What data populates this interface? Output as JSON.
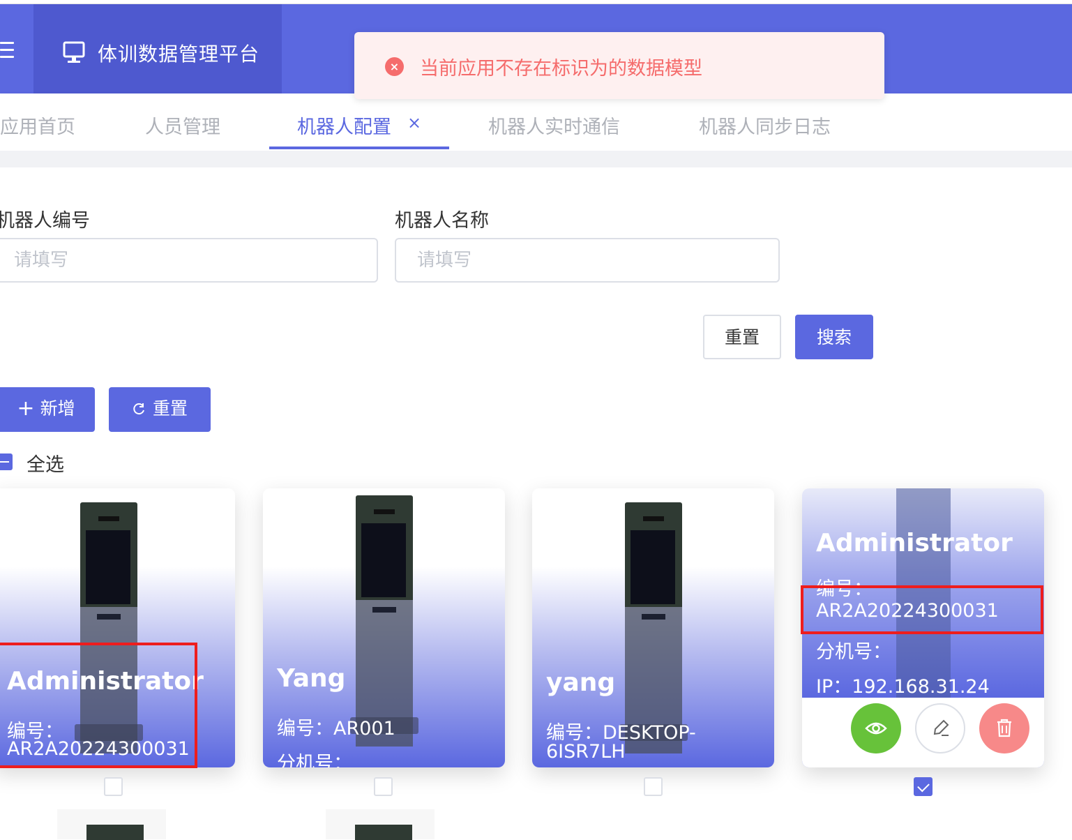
{
  "header": {
    "app_title": "体训数据管理平台",
    "menu_icon": "hamburger-icon",
    "brand_icon": "monitor-icon",
    "color_primary": "#5b68e0"
  },
  "toast": {
    "type": "error",
    "icon": "error-circle-icon",
    "message": "当前应用不存在标识为的数据模型",
    "color": "#f56c6c"
  },
  "tabs": [
    {
      "label": "应用首页",
      "active": false
    },
    {
      "label": "人员管理",
      "active": false
    },
    {
      "label": "机器人配置",
      "active": true,
      "closable": true
    },
    {
      "label": "机器人实时通信",
      "active": false
    },
    {
      "label": "机器人同步日志",
      "active": false
    }
  ],
  "tab_close_symbol": "×",
  "search_form": {
    "robot_code_label": "机器人编号",
    "robot_code_placeholder": "请填写",
    "robot_code_value": "",
    "robot_name_label": "机器人名称",
    "robot_name_placeholder": "请填写",
    "robot_name_value": "",
    "reset_label": "重置",
    "search_label": "搜索"
  },
  "toolbar": {
    "add_label": "新增",
    "add_icon": "plus-icon",
    "refresh_label": "重置",
    "refresh_icon": "refresh-icon"
  },
  "select_all": {
    "label": "全选",
    "state": "indeterminate"
  },
  "cards": [
    {
      "name": "Administrator",
      "code_line": "编号：",
      "code_value": "AR2A20224300031",
      "checked": false,
      "highlighted": true
    },
    {
      "name": "Yang",
      "code_line": "编号：AR001",
      "ext_line": "分机号：",
      "checked": false
    },
    {
      "name": "yang",
      "code_line": "编号：DESKTOP-",
      "code_value": "6ISR7LH",
      "checked": false
    },
    {
      "name": "Administrator",
      "code_line": "编号：",
      "code_value": "AR2A20224300031",
      "ext_line": "分机号：",
      "ip_line": "IP：192.168.31.24",
      "checked": true,
      "hovered": true,
      "highlighted": true,
      "actions": [
        {
          "name": "view",
          "icon": "eye-icon",
          "color": "#67c23a"
        },
        {
          "name": "edit",
          "icon": "pencil-icon",
          "color": "#ffffff"
        },
        {
          "name": "delete",
          "icon": "trash-icon",
          "color": "#f78989"
        }
      ]
    }
  ]
}
